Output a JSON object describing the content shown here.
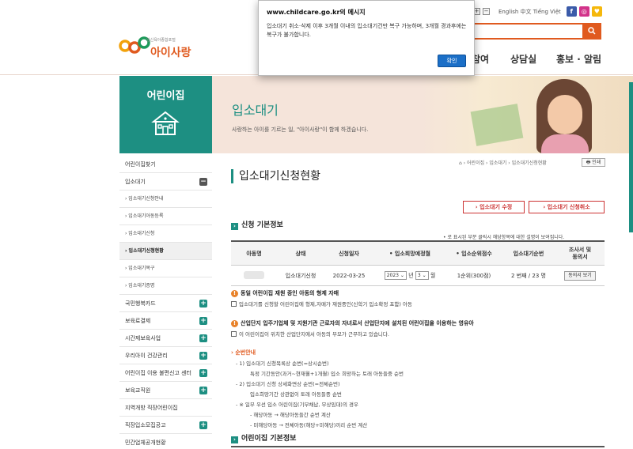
{
  "header": {
    "logo_sub": "임신육아종합포털",
    "logo_name": "아이사랑",
    "zoom_plus": "+",
    "zoom_minus": "−",
    "languages": "English 中文 Tiếng Việt",
    "sns": [
      "f",
      "◎",
      "♥"
    ],
    "search_icon": "search-icon",
    "gnb": [
      "참여",
      "상담실",
      "홍보 · 알림"
    ]
  },
  "dialog": {
    "title": "www.childcare.go.kr의 메시지",
    "message": "입소대기 취소·삭제 이후 3개월 이내의 입소대기건만 복구 가능하며, 3개월 경과후에는 복구가 불가합니다.",
    "ok": "확인"
  },
  "side": {
    "title": "어린이집"
  },
  "banner": {
    "title": "입소대기",
    "subtitle": "사랑하는 아이를 기르는 일, \"아이사랑\"이 함께 하겠습니다."
  },
  "lnb": [
    {
      "label": "어린이집찾기",
      "type": "top",
      "pm": ""
    },
    {
      "label": "입소대기",
      "type": "top",
      "pm": "−"
    },
    {
      "label": "› 입소대기신청안내",
      "type": "sub",
      "pm": ""
    },
    {
      "label": "› 입소대기아동등록",
      "type": "sub",
      "pm": ""
    },
    {
      "label": "› 입소대기신청",
      "type": "sub",
      "pm": ""
    },
    {
      "label": "› 입소대기신청현황",
      "type": "sub active",
      "pm": ""
    },
    {
      "label": "› 입소대기복구",
      "type": "sub",
      "pm": ""
    },
    {
      "label": "› 입소대기증명",
      "type": "sub",
      "pm": ""
    },
    {
      "label": "국민행복카드",
      "type": "top",
      "pm": "+"
    },
    {
      "label": "보육료결제",
      "type": "top",
      "pm": "+"
    },
    {
      "label": "시간제보육사업",
      "type": "top",
      "pm": "+"
    },
    {
      "label": "우리아이 건강관리",
      "type": "top",
      "pm": "+"
    },
    {
      "label": "어린이집 이용 불편신고 센터",
      "type": "top",
      "pm": "+"
    },
    {
      "label": "보육교직원",
      "type": "top",
      "pm": "+"
    },
    {
      "label": "지역개방 직장어린이집",
      "type": "top",
      "pm": ""
    },
    {
      "label": "직장입소모집공고",
      "type": "top",
      "pm": "+"
    },
    {
      "label": "민간업체공개현황",
      "type": "top",
      "pm": ""
    }
  ],
  "breadcrumb": "⌂  ›  어린이집  ›  입소대기  ›  입소대기신청현황",
  "print": "🖶 인쇄",
  "page_title": "입소대기신청현황",
  "buttons": {
    "modify": "›  입소대기 수정",
    "cancel": "›  입소대기 신청취소"
  },
  "section1": "신청 기본정보",
  "note": "• 로 표시된 부분 클릭시 해당항목에 대한 설명이 보여집니다.",
  "table": {
    "headers": [
      "아동명",
      "상태",
      "신청일자",
      "• 입소희망예정월",
      "• 입소순위점수",
      "입소대기순번",
      "조사서 및\n동의서"
    ],
    "row": {
      "status": "입소대기신청",
      "date": "2022-03-25",
      "year": "2023",
      "year_unit": "년",
      "month": "3",
      "month_unit": "월",
      "score": "1순위(300점)",
      "order": "2 번째 / 23 명",
      "agree": "동의서 보기"
    }
  },
  "warn1": {
    "title": "동일 어린이집 재원 중인 아동의 형제 자매",
    "check": "입소대기를 신청할 어린이집에 형제,자매가 재원중인(신학기 입소확정 포함) 아동"
  },
  "warn2": {
    "title": "산업단지 입주기업체 및 지원기관 근로자의 자녀로서 산업단지에 설치된 어린이집을 이용하는 영유아",
    "check": "이 어린이집이 위치한 산업단지에서 아동의 부모가 근무하고 있습니다."
  },
  "order_guide": {
    "title": "› 순번안내",
    "lines": [
      "- 1) 입소대기 신청목록상 순번(=상시순번)",
      "특정 기간동안(과거~현재월+1개월) 입소 희망하는 토래 아동들중 순번",
      "- 2) 입소대기 신청 상세화면상 순번(=전체순번)",
      "입소희망기간 상관없이 토래 아동들중 순번",
      "- ※ 일부 우선 입소 어린이집(기부채납, 무상임대)의 경우",
      "- 해당아동 → 해당아동들간 순번 계산",
      "- 미해당아동 → 전체아동(해당+미해당)끼리 순번 계산"
    ]
  },
  "section2": "어린이집 기본정보",
  "colors": {
    "accent": "#1d8f82",
    "brand": "#e05a1f",
    "warn": "#e8822a",
    "button_red": "#cc3333"
  }
}
